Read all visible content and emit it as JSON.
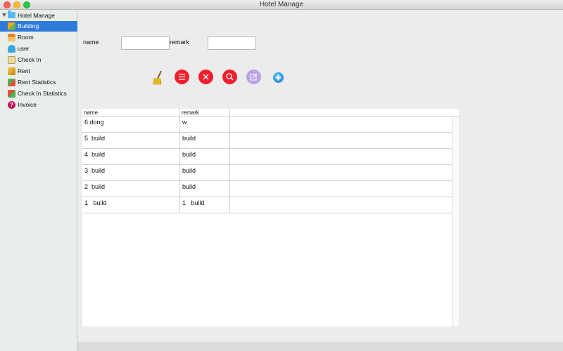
{
  "window": {
    "title": "Hotel Manage"
  },
  "sidebar": {
    "root_label": "Hotel Manage",
    "items": [
      {
        "label": "Building",
        "icon": "building-icon",
        "selected": true
      },
      {
        "label": "Room",
        "icon": "room-icon"
      },
      {
        "label": "user",
        "icon": "user-icon"
      },
      {
        "label": "Check In",
        "icon": "check-in-icon"
      },
      {
        "label": "Rent",
        "icon": "rent-icon"
      },
      {
        "label": "Rent Statistics",
        "icon": "rent-statistics-icon"
      },
      {
        "label": "Check In Statistics",
        "icon": "check-in-statistics-icon"
      },
      {
        "label": "Invoice",
        "icon": "invoice-icon",
        "glyph": "?"
      }
    ]
  },
  "form": {
    "name_label": "name",
    "name_value": "",
    "remark_label": "remark",
    "remark_value": ""
  },
  "toolbar": {
    "buttons": [
      {
        "icon": "broom-icon",
        "color": "#f0c020"
      },
      {
        "icon": "list-icon",
        "color": "#f2202e"
      },
      {
        "icon": "close-icon",
        "color": "#f2202e"
      },
      {
        "icon": "search-icon",
        "color": "#f2202e"
      },
      {
        "icon": "edit-icon",
        "color": "#b8a4e6"
      },
      {
        "icon": "add-icon",
        "color": "#1a8fe0"
      }
    ]
  },
  "table": {
    "columns": [
      "name",
      "remark"
    ],
    "rows": [
      [
        "6 dong",
        "w"
      ],
      [
        "5  build",
        "build"
      ],
      [
        "4  build",
        "build"
      ],
      [
        "3  build",
        "build"
      ],
      [
        "2  build",
        "build"
      ],
      [
        "1   build",
        "1   build"
      ]
    ]
  },
  "colors": {
    "selection": "#2f7bdc",
    "accent_red": "#f2202e"
  }
}
